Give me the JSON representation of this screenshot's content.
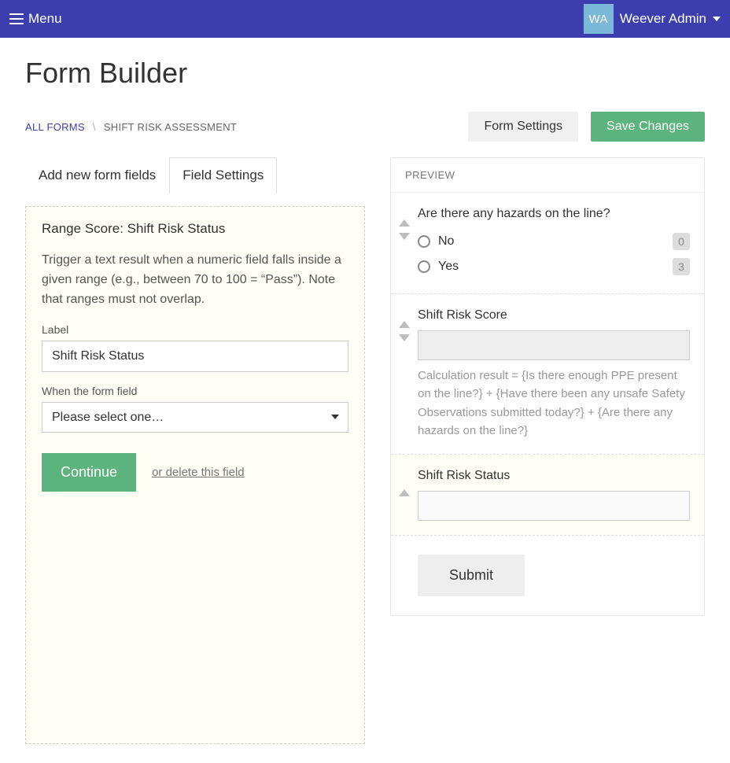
{
  "header": {
    "menu_label": "Menu",
    "user_initials": "WA",
    "user_name": "Weever Admin"
  },
  "page": {
    "title": "Form Builder"
  },
  "breadcrumbs": {
    "root": "ALL FORMS",
    "sep": "\\",
    "current": "SHIFT RISK ASSESSMENT"
  },
  "actions": {
    "form_settings": "Form Settings",
    "save_changes": "Save Changes"
  },
  "tabs": {
    "add_new": "Add new form fields",
    "field_settings": "Field Settings"
  },
  "settings": {
    "heading": "Range Score: Shift Risk Status",
    "description": "Trigger a text result when a numeric field falls inside a given range (e.g., between 70 to 100 = “Pass”). Note that ranges must not overlap.",
    "label_label": "Label",
    "label_value": "Shift Risk Status",
    "condition_label": "When the form field",
    "condition_placeholder": "Please select one…",
    "continue": "Continue",
    "delete_link": "or delete this field"
  },
  "preview": {
    "title": "PREVIEW",
    "hazards": {
      "question": "Are there any hazards on the line?",
      "options": [
        {
          "label": "No",
          "score": "0"
        },
        {
          "label": "Yes",
          "score": "3"
        }
      ]
    },
    "score": {
      "label": "Shift Risk Score",
      "calc": "Calculation result = {Is there enough PPE present on the line?} + {Have there been any unsafe Safety Observations submitted today?} + {Are there any hazards on the line?}"
    },
    "status": {
      "label": "Shift Risk Status"
    },
    "submit": "Submit"
  }
}
